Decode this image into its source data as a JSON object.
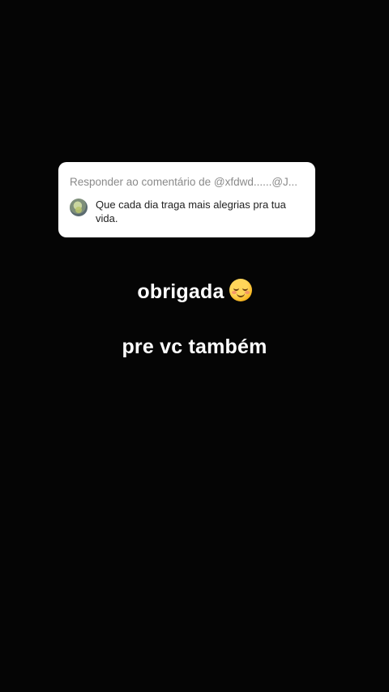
{
  "reply_card": {
    "header": "Responder ao comentário de @xfdwd......@J...",
    "comment_text": "Que cada dia traga mais alegrias pra tua vida.",
    "avatar_icon": "user-avatar"
  },
  "captions": {
    "line1_text": "obrigada",
    "line1_emoji": "☺️",
    "line2_text": "pre vc também"
  },
  "colors": {
    "background": "#050505",
    "card": "#ffffff",
    "header_text": "#8a8a8a",
    "caption_text": "#ffffff"
  }
}
